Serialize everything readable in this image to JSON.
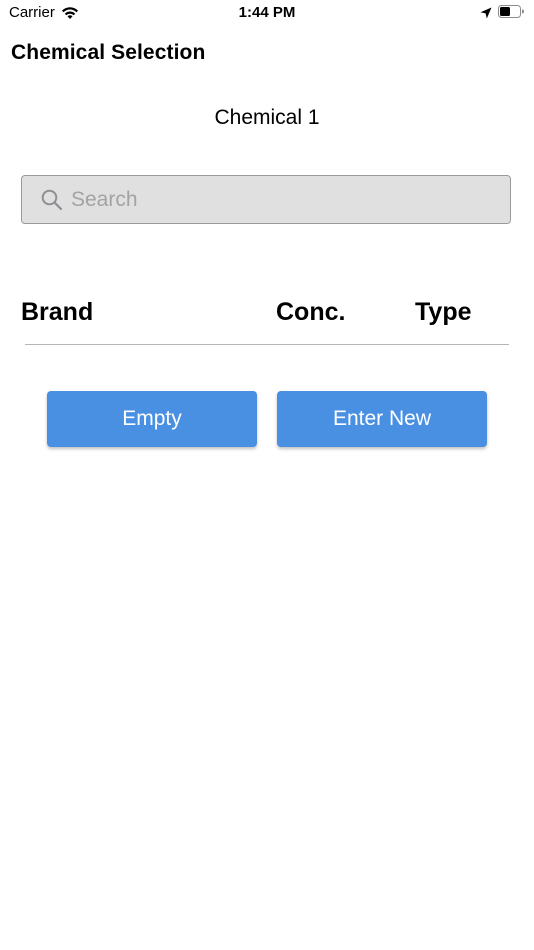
{
  "status_bar": {
    "carrier": "Carrier",
    "time": "1:44 PM",
    "icons": [
      "wifi-icon",
      "location-icon",
      "battery-icon"
    ]
  },
  "nav": {
    "title": "Chemical Selection"
  },
  "subtitle": "Chemical 1",
  "search": {
    "placeholder": "Search",
    "value": "",
    "icon": "search-icon"
  },
  "table": {
    "headers": {
      "brand": "Brand",
      "conc": "Conc.",
      "type": "Type"
    },
    "rows": []
  },
  "buttons": {
    "empty_label": "Empty",
    "enter_new_label": "Enter New"
  },
  "colors": {
    "accent": "#4a90e2",
    "search_bg": "#e0e0e0",
    "divider": "#b5b5b5"
  }
}
